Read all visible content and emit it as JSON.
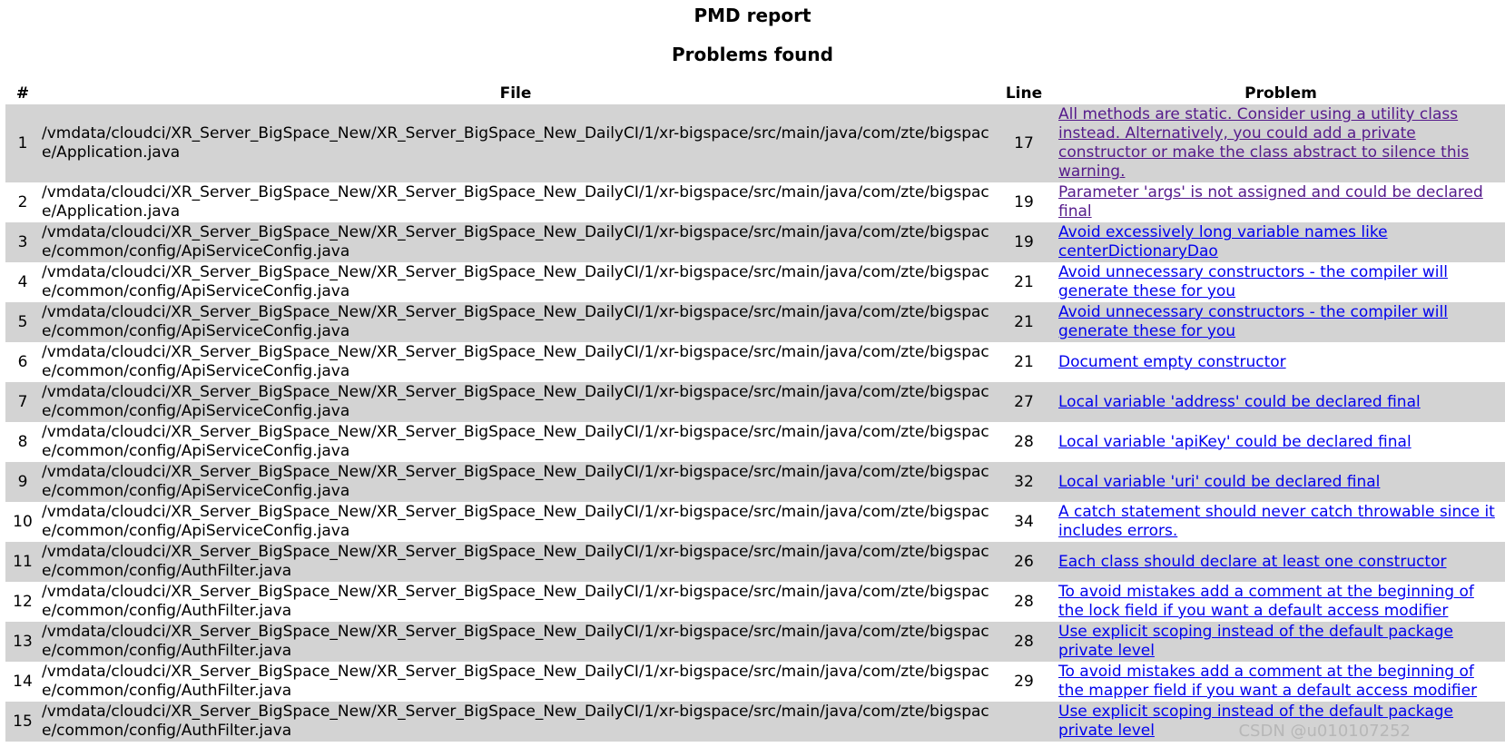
{
  "report_title": "PMD report",
  "section_title": "Problems found",
  "columns": {
    "num": "#",
    "file": "File",
    "line": "Line",
    "problem": "Problem"
  },
  "rows": [
    {
      "num": "1",
      "file": "/vmdata/cloudci/XR_Server_BigSpace_New/XR_Server_BigSpace_New_DailyCI/1/xr-bigspace/src/main/java/com/zte/bigspace/Application.java",
      "line": "17",
      "problem": "All methods are static. Consider using a utility class instead. Alternatively, you could add a private constructor or make the class abstract to silence this warning.",
      "visited": true
    },
    {
      "num": "2",
      "file": "/vmdata/cloudci/XR_Server_BigSpace_New/XR_Server_BigSpace_New_DailyCI/1/xr-bigspace/src/main/java/com/zte/bigspace/Application.java",
      "line": "19",
      "problem": "Parameter 'args' is not assigned and could be declared final",
      "visited": true
    },
    {
      "num": "3",
      "file": "/vmdata/cloudci/XR_Server_BigSpace_New/XR_Server_BigSpace_New_DailyCI/1/xr-bigspace/src/main/java/com/zte/bigspace/common/config/ApiServiceConfig.java",
      "line": "19",
      "problem": "Avoid excessively long variable names like centerDictionaryDao",
      "visited": false
    },
    {
      "num": "4",
      "file": "/vmdata/cloudci/XR_Server_BigSpace_New/XR_Server_BigSpace_New_DailyCI/1/xr-bigspace/src/main/java/com/zte/bigspace/common/config/ApiServiceConfig.java",
      "line": "21",
      "problem": "Avoid unnecessary constructors - the compiler will generate these for you",
      "visited": false
    },
    {
      "num": "5",
      "file": "/vmdata/cloudci/XR_Server_BigSpace_New/XR_Server_BigSpace_New_DailyCI/1/xr-bigspace/src/main/java/com/zte/bigspace/common/config/ApiServiceConfig.java",
      "line": "21",
      "problem": "Avoid unnecessary constructors - the compiler will generate these for you",
      "visited": false
    },
    {
      "num": "6",
      "file": "/vmdata/cloudci/XR_Server_BigSpace_New/XR_Server_BigSpace_New_DailyCI/1/xr-bigspace/src/main/java/com/zte/bigspace/common/config/ApiServiceConfig.java",
      "line": "21",
      "problem": "Document empty constructor",
      "visited": false
    },
    {
      "num": "7",
      "file": "/vmdata/cloudci/XR_Server_BigSpace_New/XR_Server_BigSpace_New_DailyCI/1/xr-bigspace/src/main/java/com/zte/bigspace/common/config/ApiServiceConfig.java",
      "line": "27",
      "problem": "Local variable 'address' could be declared final",
      "visited": false
    },
    {
      "num": "8",
      "file": "/vmdata/cloudci/XR_Server_BigSpace_New/XR_Server_BigSpace_New_DailyCI/1/xr-bigspace/src/main/java/com/zte/bigspace/common/config/ApiServiceConfig.java",
      "line": "28",
      "problem": "Local variable 'apiKey' could be declared final",
      "visited": false
    },
    {
      "num": "9",
      "file": "/vmdata/cloudci/XR_Server_BigSpace_New/XR_Server_BigSpace_New_DailyCI/1/xr-bigspace/src/main/java/com/zte/bigspace/common/config/ApiServiceConfig.java",
      "line": "32",
      "problem": "Local variable 'uri' could be declared final",
      "visited": false
    },
    {
      "num": "10",
      "file": "/vmdata/cloudci/XR_Server_BigSpace_New/XR_Server_BigSpace_New_DailyCI/1/xr-bigspace/src/main/java/com/zte/bigspace/common/config/ApiServiceConfig.java",
      "line": "34",
      "problem": "A catch statement should never catch throwable since it includes errors.",
      "visited": false
    },
    {
      "num": "11",
      "file": "/vmdata/cloudci/XR_Server_BigSpace_New/XR_Server_BigSpace_New_DailyCI/1/xr-bigspace/src/main/java/com/zte/bigspace/common/config/AuthFilter.java",
      "line": "26",
      "problem": "Each class should declare at least one constructor",
      "visited": false
    },
    {
      "num": "12",
      "file": "/vmdata/cloudci/XR_Server_BigSpace_New/XR_Server_BigSpace_New_DailyCI/1/xr-bigspace/src/main/java/com/zte/bigspace/common/config/AuthFilter.java",
      "line": "28",
      "problem": "To avoid mistakes add a comment at the beginning of the lock field if you want a default access modifier",
      "visited": false
    },
    {
      "num": "13",
      "file": "/vmdata/cloudci/XR_Server_BigSpace_New/XR_Server_BigSpace_New_DailyCI/1/xr-bigspace/src/main/java/com/zte/bigspace/common/config/AuthFilter.java",
      "line": "28",
      "problem": "Use explicit scoping instead of the default package private level",
      "visited": false
    },
    {
      "num": "14",
      "file": "/vmdata/cloudci/XR_Server_BigSpace_New/XR_Server_BigSpace_New_DailyCI/1/xr-bigspace/src/main/java/com/zte/bigspace/common/config/AuthFilter.java",
      "line": "29",
      "problem": "To avoid mistakes add a comment at the beginning of the mapper field if you want a default access modifier",
      "visited": false
    },
    {
      "num": "15",
      "file": "/vmdata/cloudci/XR_Server_BigSpace_New/XR_Server_BigSpace_New_DailyCI/1/xr-bigspace/src/main/java/com/zte/bigspace/common/config/AuthFilter.java",
      "line": "",
      "problem": "Use explicit scoping instead of the default package private level",
      "visited": false
    }
  ],
  "watermark": "CSDN @u010107252",
  "colors": {
    "row_shade": "#d3d3d3",
    "link": "#0000ee",
    "visited_link": "#551a8b"
  }
}
